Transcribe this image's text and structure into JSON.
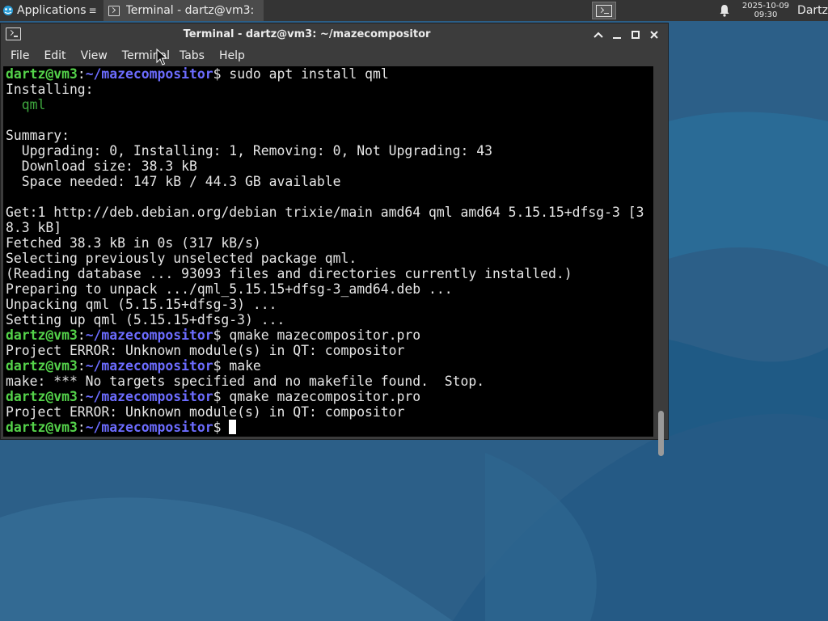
{
  "panel": {
    "applications_label": "Applications",
    "applications_icon": "xfce-logo-icon",
    "task_title": "Terminal - dartz@vm3: ...",
    "clock_date": "2025-10-09",
    "clock_time": "09:30",
    "user": "Dartz"
  },
  "window": {
    "title": "Terminal - dartz@vm3: ~/mazecompositor",
    "menu": [
      "File",
      "Edit",
      "View",
      "Terminal",
      "Tabs",
      "Help"
    ]
  },
  "colors": {
    "user_host": "#54d24a",
    "path": "#6c6cff",
    "package": "#3fa93f",
    "terminal_bg": "#000000"
  },
  "terminal": {
    "prompt_user": "dartz@vm3",
    "prompt_path": "~/mazecompositor",
    "lines": [
      {
        "type": "prompt",
        "cmd": "sudo apt install qml"
      },
      {
        "type": "text",
        "text": "Installing:"
      },
      {
        "type": "pkg",
        "text": "  qml"
      },
      {
        "type": "text",
        "text": ""
      },
      {
        "type": "text",
        "text": "Summary:"
      },
      {
        "type": "text",
        "text": "  Upgrading: 0, Installing: 1, Removing: 0, Not Upgrading: 43"
      },
      {
        "type": "text",
        "text": "  Download size: 38.3 kB"
      },
      {
        "type": "text",
        "text": "  Space needed: 147 kB / 44.3 GB available"
      },
      {
        "type": "text",
        "text": ""
      },
      {
        "type": "text",
        "text": "Get:1 http://deb.debian.org/debian trixie/main amd64 qml amd64 5.15.15+dfsg-3 [3"
      },
      {
        "type": "text",
        "text": "8.3 kB]"
      },
      {
        "type": "text",
        "text": "Fetched 38.3 kB in 0s (317 kB/s)"
      },
      {
        "type": "text",
        "text": "Selecting previously unselected package qml."
      },
      {
        "type": "text",
        "text": "(Reading database ... 93093 files and directories currently installed.)"
      },
      {
        "type": "text",
        "text": "Preparing to unpack .../qml_5.15.15+dfsg-3_amd64.deb ..."
      },
      {
        "type": "text",
        "text": "Unpacking qml (5.15.15+dfsg-3) ..."
      },
      {
        "type": "text",
        "text": "Setting up qml (5.15.15+dfsg-3) ..."
      },
      {
        "type": "prompt",
        "cmd": "qmake mazecompositor.pro"
      },
      {
        "type": "text",
        "text": "Project ERROR: Unknown module(s) in QT: compositor"
      },
      {
        "type": "prompt",
        "cmd": "make"
      },
      {
        "type": "text",
        "text": "make: *** No targets specified and no makefile found.  Stop."
      },
      {
        "type": "prompt",
        "cmd": "qmake mazecompositor.pro"
      },
      {
        "type": "text",
        "text": "Project ERROR: Unknown module(s) in QT: compositor"
      },
      {
        "type": "prompt",
        "cmd": "",
        "cursor": true
      }
    ]
  }
}
